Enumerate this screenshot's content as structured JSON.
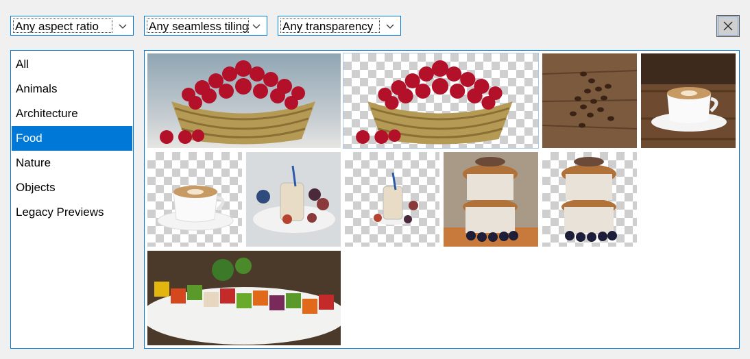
{
  "filters": {
    "aspect_ratio": "Any aspect ratio",
    "seamless_tiling": "Any seamless tiling",
    "transparency": "Any transparency"
  },
  "close_icon": "close-icon",
  "categories": [
    "All",
    "Animals",
    "Architecture",
    "Food",
    "Nature",
    "Objects",
    "Legacy Previews"
  ],
  "selected_category": "Food",
  "images": [
    {
      "subject": "cherries-basket",
      "transparent": false
    },
    {
      "subject": "cherries-basket",
      "transparent": true
    },
    {
      "subject": "coffee-beans",
      "transparent": false
    },
    {
      "subject": "coffee-cup",
      "transparent": false
    },
    {
      "subject": "coffee-cup",
      "transparent": true
    },
    {
      "subject": "smoothie-figs",
      "transparent": false
    },
    {
      "subject": "smoothie-figs",
      "transparent": true
    },
    {
      "subject": "muffins",
      "transparent": false
    },
    {
      "subject": "muffins",
      "transparent": true
    },
    {
      "subject": "vegetable-skewers",
      "transparent": false
    }
  ],
  "colors": {
    "accent": "#0078d7",
    "selected_bg": "#0078d7",
    "window_bg": "#f0f0f0"
  }
}
